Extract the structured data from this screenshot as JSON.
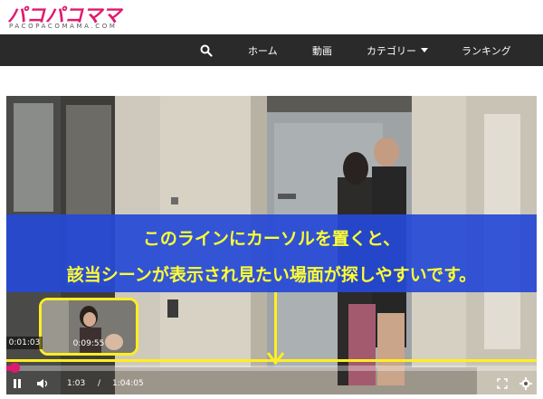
{
  "header": {
    "logo_text": "パコパコママ",
    "logo_sub": "PACOPACOMAMA.COM",
    "brand_color": "#e0196e"
  },
  "nav": {
    "search_icon": "search-icon",
    "items": [
      {
        "label": "ホーム"
      },
      {
        "label": "動画"
      },
      {
        "label": "カテゴリー"
      },
      {
        "label": "ランキング"
      }
    ]
  },
  "overlay": {
    "line1": "このラインにカーソルを置くと、",
    "line2": "該当シーンが表示され見たい場面が探しやすいです。",
    "text_color": "#ffff33",
    "box_color": "#2549d6"
  },
  "preview": {
    "thumb_time": "0:09:55",
    "hover_time": "0:01:03"
  },
  "player": {
    "progress": 0.016,
    "current_time": "1:03",
    "separator": "/",
    "duration": "1:04:05",
    "icons": [
      "pause-icon",
      "volume-icon",
      "fullscreen-icon",
      "settings-icon"
    ]
  }
}
